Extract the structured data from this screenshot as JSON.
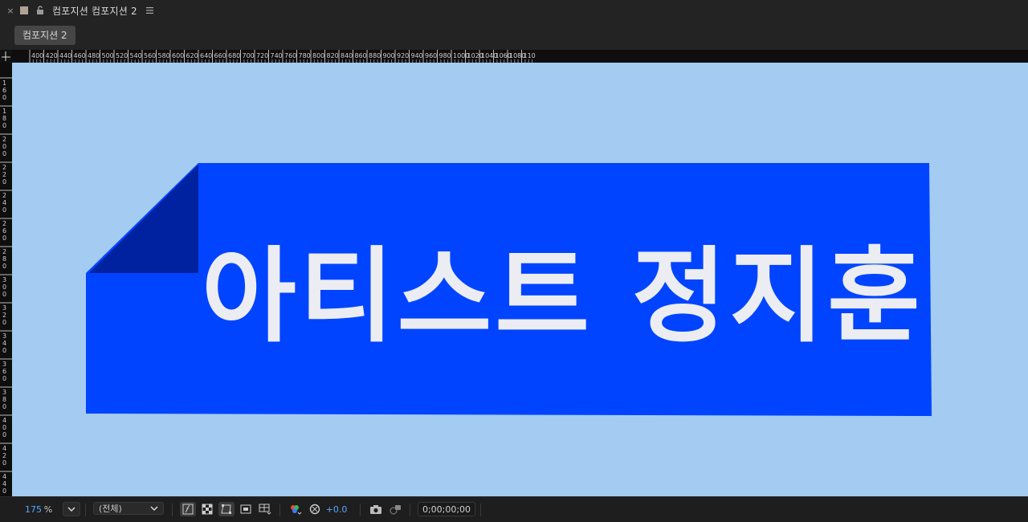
{
  "panel": {
    "close_label": "×",
    "title": "컴포지션 컴포지션 2",
    "tab_label": "컴포지션 2"
  },
  "rulers": {
    "horizontal_labels": [
      "400",
      "420",
      "440",
      "460",
      "480",
      "500",
      "520",
      "540",
      "560",
      "580",
      "600",
      "620",
      "640",
      "660",
      "680",
      "700",
      "720",
      "740",
      "760",
      "780",
      "800",
      "820",
      "840",
      "860",
      "880",
      "900",
      "920",
      "940",
      "960",
      "980",
      "1000",
      "1020",
      "1040",
      "1060",
      "1080",
      "110"
    ],
    "vertical_labels": [
      "160",
      "180",
      "200",
      "220",
      "240",
      "260",
      "280",
      "300",
      "320",
      "340",
      "360",
      "380",
      "400",
      "420",
      "440"
    ]
  },
  "canvas": {
    "background_color": "#a4cbf1",
    "banner_color": "#0044ff",
    "fold_color": "#0022a0",
    "text_color": "#ecedf2",
    "banner_text": "아티스트 정지훈"
  },
  "toolbar": {
    "zoom_value": "175",
    "zoom_unit": "%",
    "resolution": "(전체)",
    "exposure": "+0.0",
    "timecode": "0;00;00;00",
    "accent_color": "#5aa6ff"
  }
}
